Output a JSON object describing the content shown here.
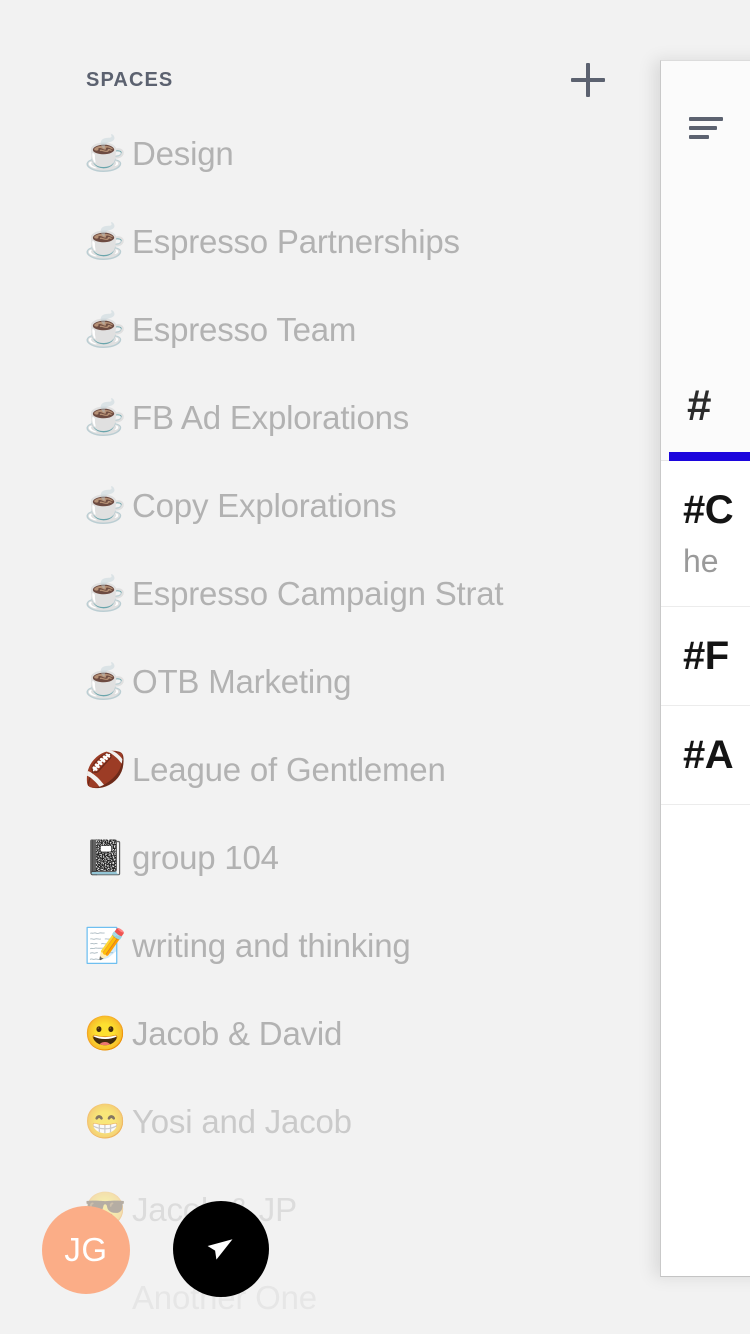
{
  "spaces_panel": {
    "header_title": "SPACES",
    "add_button_label": "+",
    "items": [
      {
        "emoji": "☕",
        "emoji_name": "hot-beverage-emoji",
        "label": "Design",
        "fade": ""
      },
      {
        "emoji": "☕",
        "emoji_name": "hot-beverage-emoji",
        "label": "Espresso Partnerships",
        "fade": ""
      },
      {
        "emoji": "☕",
        "emoji_name": "hot-beverage-emoji",
        "label": "Espresso Team",
        "fade": ""
      },
      {
        "emoji": "☕",
        "emoji_name": "hot-beverage-emoji",
        "label": "FB Ad Explorations",
        "fade": ""
      },
      {
        "emoji": "☕",
        "emoji_name": "hot-beverage-emoji",
        "label": "Copy Explorations",
        "fade": ""
      },
      {
        "emoji": "☕",
        "emoji_name": "hot-beverage-emoji",
        "label": "Espresso Campaign Strat",
        "fade": ""
      },
      {
        "emoji": "☕",
        "emoji_name": "hot-beverage-emoji",
        "label": "OTB Marketing",
        "fade": ""
      },
      {
        "emoji": "🏈",
        "emoji_name": "american-football-emoji",
        "label": "League of Gentlemen",
        "fade": ""
      },
      {
        "emoji": "📓",
        "emoji_name": "notebook-emoji",
        "label": "group 104",
        "fade": ""
      },
      {
        "emoji": "📝",
        "emoji_name": "memo-emoji",
        "label": "writing and thinking",
        "fade": ""
      },
      {
        "emoji": "😀",
        "emoji_name": "grinning-face-emoji",
        "label": "Jacob & David",
        "fade": ""
      },
      {
        "emoji": "😁",
        "emoji_name": "beaming-face-emoji",
        "label": "Yosi and Jacob",
        "fade": "fade-1"
      },
      {
        "emoji": "😎",
        "emoji_name": "sunglasses-face-emoji",
        "label": "Jacob & JP",
        "fade": "fade-2"
      },
      {
        "emoji": "",
        "emoji_name": "no-emoji",
        "label": "Another One",
        "fade": "fade-3"
      }
    ]
  },
  "drawer": {
    "menu_icon_label": "menu",
    "tabs": [
      {
        "label": "#",
        "active": true
      }
    ],
    "channels": [
      {
        "name": "#C",
        "preview": "he"
      },
      {
        "name": "#F",
        "preview": ""
      },
      {
        "name": "#A",
        "preview": ""
      }
    ]
  },
  "bottom_controls": {
    "avatar_initials": "JG",
    "fab_icon": "navigation-arrow-icon"
  },
  "colors": {
    "background": "#f2f2f2",
    "header_text": "#5c6270",
    "list_text": "#b2b2b2",
    "drawer_background": "#ffffff",
    "active_tab_underline": "#1c06dd",
    "avatar_background": "#fbad87",
    "fab_background": "#000000"
  }
}
